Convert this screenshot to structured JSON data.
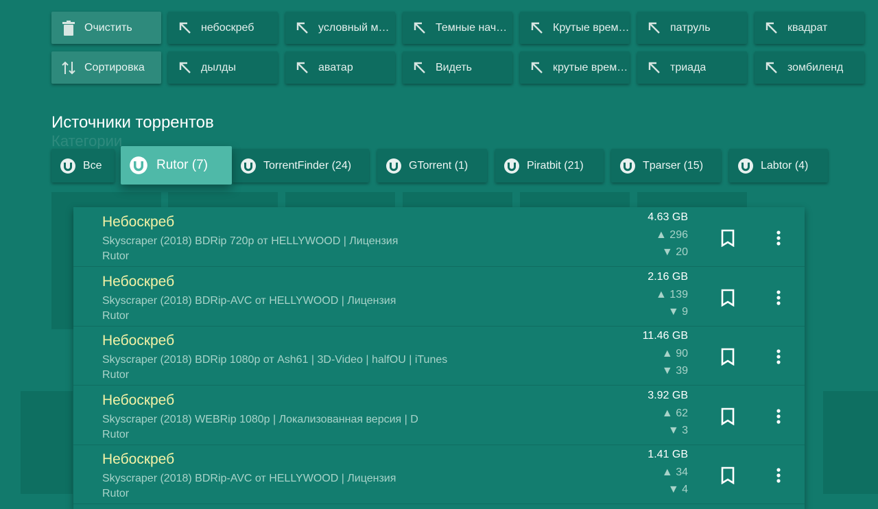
{
  "history": {
    "clear_label": "Очистить",
    "sort_label": "Сортировка",
    "row1": [
      "небоскреб",
      "условный ме…",
      "Темные нача…",
      "Крутые врем…",
      "патруль",
      "квадрат"
    ],
    "row2": [
      "дылды",
      "аватар",
      "Видеть",
      "крутые врем…",
      "триада",
      "зомбиленд"
    ]
  },
  "sources": {
    "title": "Источники торрентов",
    "ghost_label": "Категории",
    "items": [
      {
        "label": "Все"
      },
      {
        "label": "Rutor (7)"
      },
      {
        "label": "TorrentFinder (24)"
      },
      {
        "label": "GTorrent (1)"
      },
      {
        "label": "Piratbit (21)"
      },
      {
        "label": "Tparser (15)"
      },
      {
        "label": "Labtor (4)"
      }
    ],
    "active_index": 1
  },
  "results": [
    {
      "title": "Небоскреб",
      "desc": "Skyscraper (2018) BDRip 720p от HELLYWOOD | Лицензия",
      "source": "Rutor",
      "size": "4.63 GB",
      "seeds": "▲ 296",
      "peers": "▼ 20"
    },
    {
      "title": "Небоскреб",
      "desc": "Skyscraper (2018) BDRip-AVC от HELLYWOOD | Лицензия",
      "source": "Rutor",
      "size": "2.16 GB",
      "seeds": "▲ 139",
      "peers": "▼ 9"
    },
    {
      "title": "Небоскреб",
      "desc": "Skyscraper (2018) BDRip 1080p от Ash61 | 3D-Video | halfOU | iTunes",
      "source": "Rutor",
      "size": "11.46 GB",
      "seeds": "▲ 90",
      "peers": "▼ 39"
    },
    {
      "title": "Небоскреб",
      "desc": "Skyscraper (2018) WEBRip 1080p | Локализованная версия | D",
      "source": "Rutor",
      "size": "3.92 GB",
      "seeds": "▲ 62",
      "peers": "▼ 3"
    },
    {
      "title": "Небоскреб",
      "desc": "Skyscraper (2018) BDRip-AVC от HELLYWOOD | Лицензия",
      "source": "Rutor",
      "size": "1.41 GB",
      "seeds": "▲ 34",
      "peers": "▼ 4"
    }
  ],
  "colors": {
    "background": "#127a6c",
    "accent": "#4fb9a8",
    "title": "#f4f2a6"
  }
}
